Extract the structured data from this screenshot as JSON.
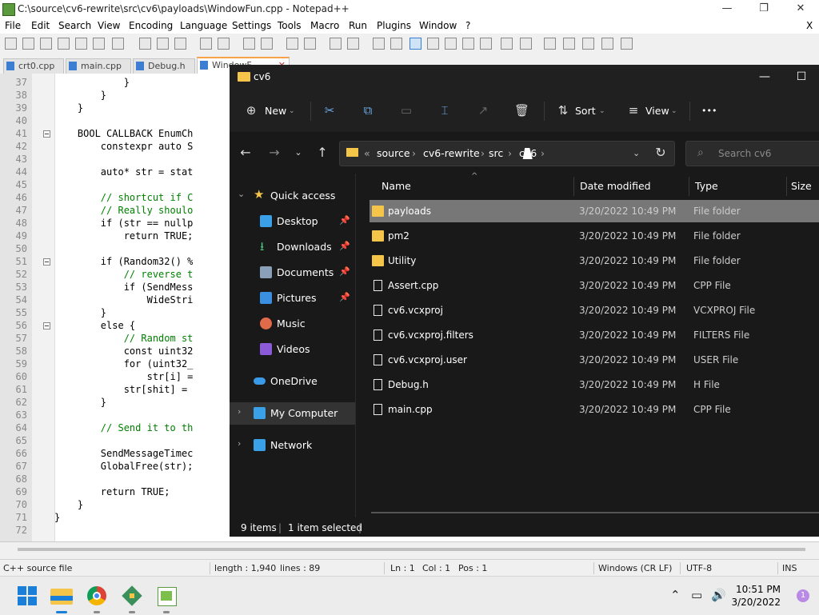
{
  "npp": {
    "title": "C:\\source\\cv6-rewrite\\src\\cv6\\payloads\\WindowFun.cpp - Notepad++",
    "close_x": "X",
    "menu": [
      "File",
      "Edit",
      "Search",
      "View",
      "Encoding",
      "Language",
      "Settings",
      "Tools",
      "Macro",
      "Run",
      "Plugins",
      "Window",
      "?"
    ],
    "tabs": [
      {
        "label": "crt0.cpp",
        "active": false
      },
      {
        "label": "main.cpp",
        "active": false
      },
      {
        "label": "Debug.h",
        "active": false
      },
      {
        "label": "WindowF",
        "active": true
      }
    ],
    "lines": [
      {
        "n": "37",
        "code": "            }"
      },
      {
        "n": "38",
        "code": "        }"
      },
      {
        "n": "39",
        "code": "    }"
      },
      {
        "n": "40",
        "code": ""
      },
      {
        "n": "41",
        "code": "    BOOL CALLBACK EnumCh"
      },
      {
        "n": "42",
        "code": "        constexpr auto S"
      },
      {
        "n": "43",
        "code": ""
      },
      {
        "n": "44",
        "code": "        auto* str = stat"
      },
      {
        "n": "45",
        "code": ""
      },
      {
        "n": "46",
        "code": "        // shortcut if C"
      },
      {
        "n": "47",
        "code": "        // Really shoulo"
      },
      {
        "n": "48",
        "code": "        if (str == nullp"
      },
      {
        "n": "49",
        "code": "            return TRUE;"
      },
      {
        "n": "50",
        "code": ""
      },
      {
        "n": "51",
        "code": "        if (Random32() %"
      },
      {
        "n": "52",
        "code": "            // reverse t"
      },
      {
        "n": "53",
        "code": "            if (SendMess"
      },
      {
        "n": "54",
        "code": "                WideStri"
      },
      {
        "n": "55",
        "code": "        }"
      },
      {
        "n": "56",
        "code": "        else {"
      },
      {
        "n": "57",
        "code": "            // Random st"
      },
      {
        "n": "58",
        "code": "            const uint32"
      },
      {
        "n": "59",
        "code": "            for (uint32_"
      },
      {
        "n": "60",
        "code": "                str[i] ="
      },
      {
        "n": "61",
        "code": "            str[shit] ="
      },
      {
        "n": "62",
        "code": "        }"
      },
      {
        "n": "63",
        "code": ""
      },
      {
        "n": "64",
        "code": "        // Send it to th"
      },
      {
        "n": "65",
        "code": ""
      },
      {
        "n": "66",
        "code": "        SendMessageTimec"
      },
      {
        "n": "67",
        "code": "        GlobalFree(str);"
      },
      {
        "n": "68",
        "code": ""
      },
      {
        "n": "69",
        "code": "        return TRUE;"
      },
      {
        "n": "70",
        "code": "    }"
      },
      {
        "n": "71",
        "code": "}"
      },
      {
        "n": "72",
        "code": ""
      }
    ],
    "status": {
      "file_type": "C++ source file",
      "length": "length : 1,940",
      "lines": "lines : 89",
      "ln": "Ln : 1",
      "col": "Col : 1",
      "pos": "Pos : 1",
      "eol": "Windows (CR LF)",
      "encoding": "UTF-8",
      "mode": "INS"
    }
  },
  "explorer": {
    "title": "cv6",
    "cmd": {
      "new": "New",
      "sort": "Sort",
      "view": "View",
      "more": "•••"
    },
    "address": {
      "prefix": "«",
      "crumbs": [
        "source",
        "cv6-rewrite",
        "src",
        "cv6"
      ]
    },
    "search_placeholder": "Search cv6",
    "nav": [
      {
        "label": "Quick access",
        "icon": "star-icon",
        "color": "#f5c54a"
      },
      {
        "label": "Desktop",
        "icon": "desktop-icon",
        "color": "#3aa0e8"
      },
      {
        "label": "Downloads",
        "icon": "download-icon",
        "color": "#4cc27a"
      },
      {
        "label": "Documents",
        "icon": "document-icon",
        "color": "#8aa0b8"
      },
      {
        "label": "Pictures",
        "icon": "pictures-icon",
        "color": "#3a8fe0"
      },
      {
        "label": "Music",
        "icon": "music-icon",
        "color": "#e06a4a"
      },
      {
        "label": "Videos",
        "icon": "videos-icon",
        "color": "#8a5ad8"
      },
      {
        "label": "OneDrive",
        "icon": "cloud-icon",
        "color": "#3a9ae8"
      },
      {
        "label": "My Computer",
        "icon": "computer-icon",
        "color": "#3aa0e8"
      },
      {
        "label": "Network",
        "icon": "network-icon",
        "color": "#3aa0e8"
      }
    ],
    "columns": {
      "name": "Name",
      "date": "Date modified",
      "type": "Type",
      "size": "Size"
    },
    "files": [
      {
        "name": "payloads",
        "date": "3/20/2022 10:49 PM",
        "type": "File folder",
        "kind": "folder",
        "selected": true
      },
      {
        "name": "pm2",
        "date": "3/20/2022 10:49 PM",
        "type": "File folder",
        "kind": "folder",
        "selected": false
      },
      {
        "name": "Utility",
        "date": "3/20/2022 10:49 PM",
        "type": "File folder",
        "kind": "folder",
        "selected": false
      },
      {
        "name": "Assert.cpp",
        "date": "3/20/2022 10:49 PM",
        "type": "CPP File",
        "kind": "file",
        "selected": false
      },
      {
        "name": "cv6.vcxproj",
        "date": "3/20/2022 10:49 PM",
        "type": "VCXPROJ File",
        "kind": "file",
        "selected": false
      },
      {
        "name": "cv6.vcxproj.filters",
        "date": "3/20/2022 10:49 PM",
        "type": "FILTERS File",
        "kind": "file",
        "selected": false
      },
      {
        "name": "cv6.vcxproj.user",
        "date": "3/20/2022 10:49 PM",
        "type": "USER File",
        "kind": "file",
        "selected": false
      },
      {
        "name": "Debug.h",
        "date": "3/20/2022 10:49 PM",
        "type": "H File",
        "kind": "file",
        "selected": false
      },
      {
        "name": "main.cpp",
        "date": "3/20/2022 10:49 PM",
        "type": "CPP File",
        "kind": "file",
        "selected": false
      }
    ],
    "status": {
      "items": "9 items",
      "selected": "1 item selected"
    }
  },
  "taskbar": {
    "time": "10:51 PM",
    "date": "3/20/2022",
    "notifications": "1"
  }
}
